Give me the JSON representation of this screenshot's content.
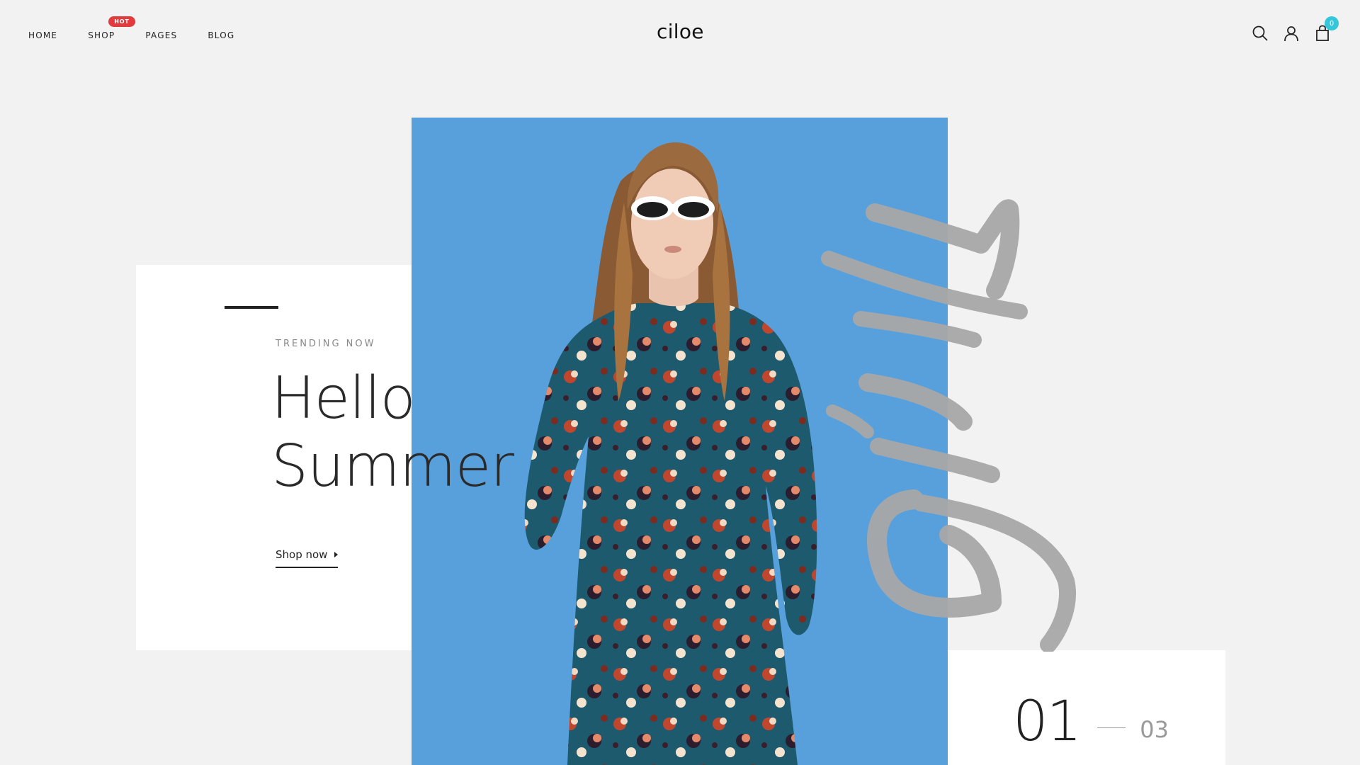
{
  "header": {
    "logo": "ciloe",
    "nav": [
      {
        "label": "HOME"
      },
      {
        "label": "SHOP",
        "badge": "HOT"
      },
      {
        "label": "PAGES"
      },
      {
        "label": "BLOG"
      }
    ],
    "icons": [
      "search-icon",
      "user-icon",
      "cart-icon"
    ],
    "cart_count": "0"
  },
  "hero": {
    "eyebrow": "TRENDING NOW",
    "title_line1": "Hello",
    "title_line2": "Summer",
    "cta": "Shop now",
    "counter_current": "01",
    "counter_total": "03"
  },
  "colors": {
    "page_bg": "#f2f2f2",
    "image_bg": "#58a0dc",
    "badge": "#e33a3d",
    "cart_badge": "#35c6d9",
    "brush": "#a8a8a8"
  }
}
